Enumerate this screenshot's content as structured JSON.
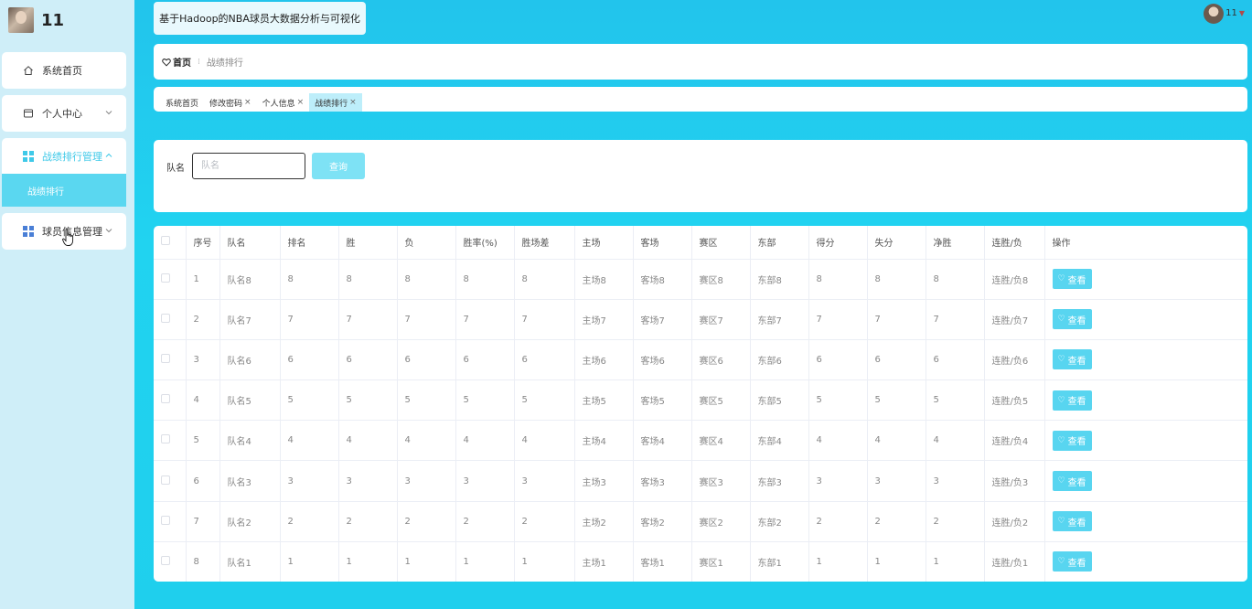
{
  "sidebar": {
    "username": "11",
    "menu": [
      {
        "label": "系统首页"
      },
      {
        "label": "个人中心"
      },
      {
        "label": "战绩排行管理"
      },
      {
        "label": "球员信息管理"
      }
    ],
    "submenu": {
      "label": "战绩排行"
    }
  },
  "header": {
    "title": "基于Hadoop的NBA球员大数据分析与可视化",
    "user": "11"
  },
  "breadcrumb": {
    "home": "首页",
    "current": "战绩排行"
  },
  "tabs": [
    {
      "label": "系统首页"
    },
    {
      "label": "修改密码"
    },
    {
      "label": "个人信息"
    },
    {
      "label": "战绩排行"
    }
  ],
  "search": {
    "label": "队名",
    "placeholder": "队名",
    "button": "查询"
  },
  "table": {
    "headers": [
      "序号",
      "队名",
      "排名",
      "胜",
      "负",
      "胜率(%)",
      "胜场差",
      "主场",
      "客场",
      "赛区",
      "东部",
      "得分",
      "失分",
      "净胜",
      "连胜/负",
      "操作"
    ],
    "action_label": "查看",
    "rows": [
      [
        "1",
        "队名8",
        "8",
        "8",
        "8",
        "8",
        "8",
        "主场8",
        "客场8",
        "赛区8",
        "东部8",
        "8",
        "8",
        "8",
        "连胜/负8"
      ],
      [
        "2",
        "队名7",
        "7",
        "7",
        "7",
        "7",
        "7",
        "主场7",
        "客场7",
        "赛区7",
        "东部7",
        "7",
        "7",
        "7",
        "连胜/负7"
      ],
      [
        "3",
        "队名6",
        "6",
        "6",
        "6",
        "6",
        "6",
        "主场6",
        "客场6",
        "赛区6",
        "东部6",
        "6",
        "6",
        "6",
        "连胜/负6"
      ],
      [
        "4",
        "队名5",
        "5",
        "5",
        "5",
        "5",
        "5",
        "主场5",
        "客场5",
        "赛区5",
        "东部5",
        "5",
        "5",
        "5",
        "连胜/负5"
      ],
      [
        "5",
        "队名4",
        "4",
        "4",
        "4",
        "4",
        "4",
        "主场4",
        "客场4",
        "赛区4",
        "东部4",
        "4",
        "4",
        "4",
        "连胜/负4"
      ],
      [
        "6",
        "队名3",
        "3",
        "3",
        "3",
        "3",
        "3",
        "主场3",
        "客场3",
        "赛区3",
        "东部3",
        "3",
        "3",
        "3",
        "连胜/负3"
      ],
      [
        "7",
        "队名2",
        "2",
        "2",
        "2",
        "2",
        "2",
        "主场2",
        "客场2",
        "赛区2",
        "东部2",
        "2",
        "2",
        "2",
        "连胜/负2"
      ],
      [
        "8",
        "队名1",
        "1",
        "1",
        "1",
        "1",
        "1",
        "主场1",
        "客场1",
        "赛区1",
        "东部1",
        "1",
        "1",
        "1",
        "连胜/负1"
      ]
    ]
  },
  "colors": {
    "accent": "#3fc9e8",
    "button": "#58d5f0",
    "background": "#29c6ea"
  }
}
